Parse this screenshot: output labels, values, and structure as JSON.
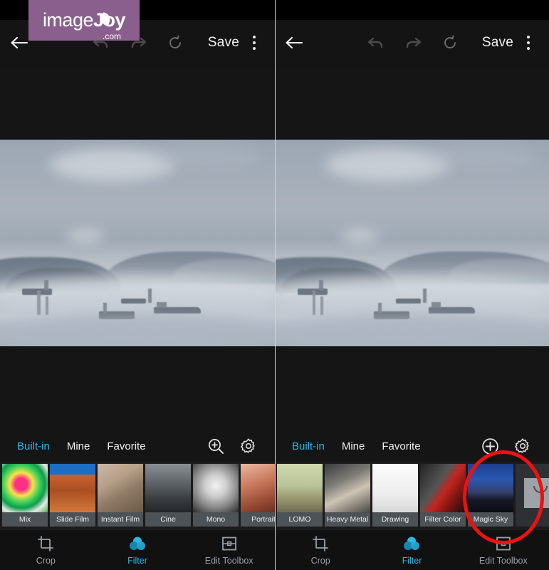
{
  "app": {
    "watermark": {
      "text_light": "image",
      "text_bold": "J",
      "text_bold2": "y",
      "text_o": "o",
      "suffix": ".com",
      "bg_color": "#8a5f8e"
    }
  },
  "accent_color": "#2ab8e6",
  "annotation": {
    "shape": "ellipse",
    "color": "#ee1111",
    "target": "Magic Sky"
  },
  "panels": [
    {
      "id": "left",
      "toolbar": {
        "back_label": "back-arrow",
        "undo_label": "undo",
        "redo_label": "redo",
        "reset_label": "reset",
        "save_label": "Save",
        "overflow_label": "more-options"
      },
      "photo": {
        "alt": "Misty seascape with mountains and ships in fog"
      },
      "filter_tabs": {
        "items": [
          {
            "label": "Built-in",
            "active": true
          },
          {
            "label": "Mine",
            "active": false
          },
          {
            "label": "Favorite",
            "active": false
          }
        ],
        "action_icons": [
          {
            "name": "magnifier-plus-icon"
          },
          {
            "name": "gear-icon"
          }
        ]
      },
      "filters": [
        {
          "label": "Mix",
          "art": "tp-mix"
        },
        {
          "label": "Slide Film",
          "art": "tp-slide"
        },
        {
          "label": "Instant Film",
          "art": "tp-instant"
        },
        {
          "label": "Cine",
          "art": "tp-cine"
        },
        {
          "label": "Mono",
          "art": "tp-mono"
        },
        {
          "label": "Portrait",
          "art": "tp-portrait"
        }
      ],
      "bottom_nav": [
        {
          "label": "Crop",
          "icon": "crop-icon",
          "active": false
        },
        {
          "label": "Filter",
          "icon": "filter-circles-icon",
          "active": true
        },
        {
          "label": "Edit Toolbox",
          "icon": "edit-toolbox-icon",
          "active": false
        }
      ]
    },
    {
      "id": "right",
      "toolbar": {
        "back_label": "back-arrow",
        "undo_label": "undo",
        "redo_label": "redo",
        "reset_label": "reset",
        "save_label": "Save",
        "overflow_label": "more-options"
      },
      "photo": {
        "alt": "Misty seascape with mountains and ships in fog"
      },
      "filter_tabs": {
        "items": [
          {
            "label": "Built-in",
            "active": true
          },
          {
            "label": "Mine",
            "active": false
          },
          {
            "label": "Favorite",
            "active": false
          }
        ],
        "action_icons": [
          {
            "name": "plus-circle-icon"
          },
          {
            "name": "gear-icon"
          }
        ]
      },
      "filters": [
        {
          "label": "LOMO",
          "art": "tp-lomo"
        },
        {
          "label": "Heavy Metal",
          "art": "tp-heavy"
        },
        {
          "label": "Drawing",
          "art": "tp-drawing"
        },
        {
          "label": "Filter Color",
          "art": "tp-filtercolor"
        },
        {
          "label": "Magic Sky",
          "art": "tp-magicsky"
        },
        {
          "label": "",
          "art": "placeholder"
        }
      ],
      "bottom_nav": [
        {
          "label": "Crop",
          "icon": "crop-icon",
          "active": false
        },
        {
          "label": "Filter",
          "icon": "filter-circles-icon",
          "active": true
        },
        {
          "label": "Edit Toolbox",
          "icon": "edit-toolbox-icon",
          "active": false
        }
      ]
    }
  ]
}
